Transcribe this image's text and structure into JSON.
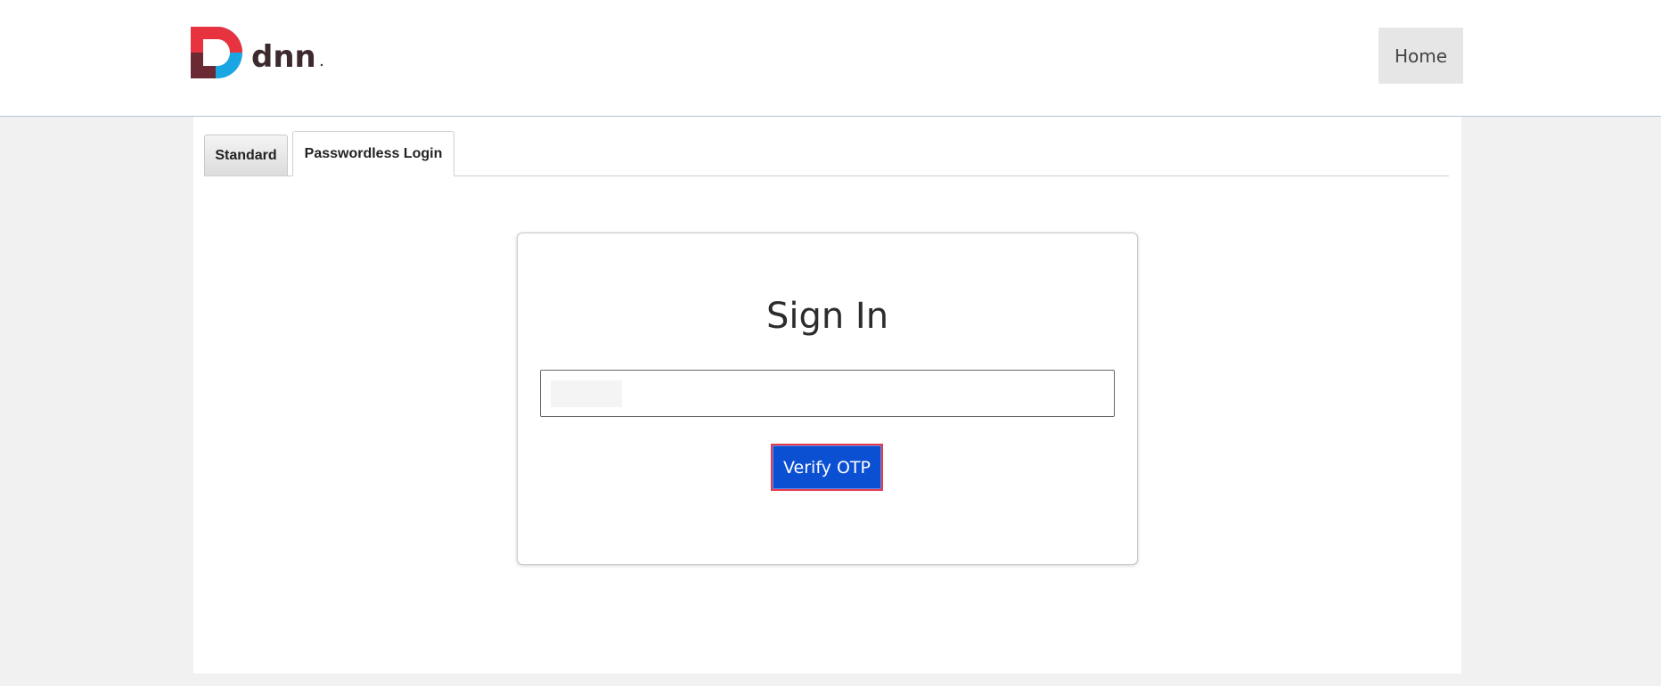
{
  "header": {
    "logo_text": "dnn",
    "home_label": "Home"
  },
  "tabs": [
    {
      "label": "Standard",
      "active": false
    },
    {
      "label": "Passwordless Login",
      "active": true
    }
  ],
  "signin": {
    "title": "Sign In",
    "otp_input_value": "",
    "otp_input_placeholder": "",
    "verify_label": "Verify OTP"
  },
  "colors": {
    "logo_red": "#e7323f",
    "logo_dark": "#6b2a33",
    "logo_blue": "#1aa6e2",
    "logo_text": "#3c2a2e",
    "button_blue": "#0b4fd3",
    "button_outline": "#e63b4e"
  }
}
